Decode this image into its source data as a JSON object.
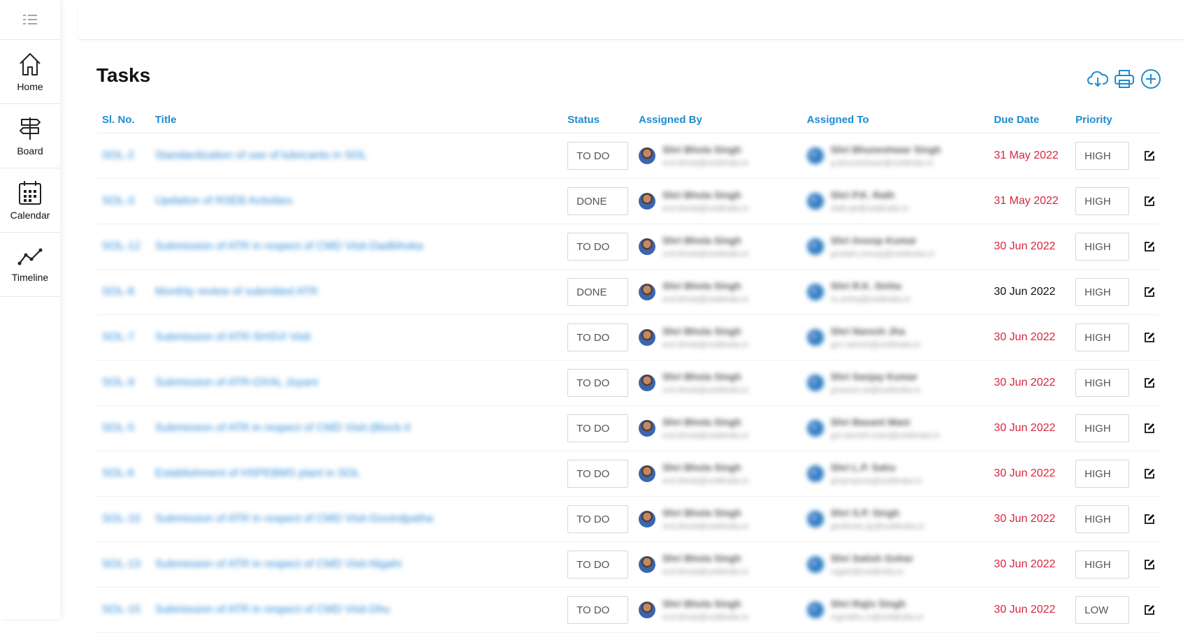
{
  "sidebar": {
    "items": [
      {
        "label": "Home",
        "icon": "home-icon"
      },
      {
        "label": "Board",
        "icon": "signpost-icon"
      },
      {
        "label": "Calendar",
        "icon": "calendar-icon"
      },
      {
        "label": "Timeline",
        "icon": "timeline-icon"
      }
    ]
  },
  "header": {
    "theme_toggle": "off",
    "avatar": "user-avatar"
  },
  "page": {
    "title": "Tasks",
    "actions": [
      "download-icon",
      "print-icon",
      "add-icon"
    ]
  },
  "colors": {
    "accent": "#1e8cd0",
    "overdue": "#d7263d"
  },
  "table": {
    "headers": {
      "sl_no": "Sl. No.",
      "title": "Title",
      "status": "Status",
      "assigned_by": "Assigned By",
      "assigned_to": "Assigned To",
      "due_date": "Due Date",
      "priority": "Priority"
    },
    "rows": [
      {
        "sl": "SOL-2",
        "title": "Standardization of use of lubricants in SOL",
        "status": "TO DO",
        "by_name": "Shri Bhola Singh",
        "by_email": "srsl.bhola@soldindia.in",
        "to_name": "Shri Bhuneshwar Singh",
        "to_email": "g.bhuneshwar@soldindia.in",
        "due": "31 May 2022",
        "overdue": true,
        "priority": "HIGH"
      },
      {
        "sl": "SOL-3",
        "title": "Updation of RSEB Activities",
        "status": "DONE",
        "by_name": "Shri Bhola Singh",
        "by_email": "srsl.bhola@soldindia.in",
        "to_name": "Shri P.K. Rath",
        "to_email": "rtlab.pk@soldindia.in",
        "due": "31 May 2022",
        "overdue": true,
        "priority": "HIGH"
      },
      {
        "sl": "SOL-12",
        "title": "Submission of ATR in respect of CMD Visit-Dadibhoka",
        "status": "TO DO",
        "by_name": "Shri Bhola Singh",
        "by_email": "srsl.bhola@soldindia.in",
        "to_name": "Shri Anoop Kumar",
        "to_email": "gmadm.anoop@soldindia.in",
        "due": "30 Jun 2022",
        "overdue": true,
        "priority": "HIGH"
      },
      {
        "sl": "SOL-8",
        "title": "Monthly review of submitted ATR",
        "status": "DONE",
        "by_name": "Shri Bhola Singh",
        "by_email": "srsl.bhola@soldindia.in",
        "to_name": "Shri R.K. Sinha",
        "to_email": "rs.sinha@soldindia.in",
        "due": "30 Jun 2022",
        "overdue": false,
        "priority": "HIGH"
      },
      {
        "sl": "SOL-7",
        "title": "Submission of ATR-SHSVI Visit",
        "status": "TO DO",
        "by_name": "Shri Bhola Singh",
        "by_email": "srsl.bhola@soldindia.in",
        "to_name": "Shri Naresh Jha",
        "to_email": "gm.naresh@soldindia.in",
        "due": "30 Jun 2022",
        "overdue": true,
        "priority": "HIGH"
      },
      {
        "sl": "SOL-9",
        "title": "Submission of ATR-OXAL Joyani",
        "status": "TO DO",
        "by_name": "Shri Bhola Singh",
        "by_email": "srsl.bhola@soldindia.in",
        "to_name": "Shri Sanjay Kumar",
        "to_email": "gmwest.sk@soldindia.in",
        "due": "30 Jun 2022",
        "overdue": true,
        "priority": "HIGH"
      },
      {
        "sl": "SOL-5",
        "title": "Submission of ATR in respect of CMD Visit-(Block-II",
        "status": "TO DO",
        "by_name": "Shri Bhola Singh",
        "by_email": "srsl.bhola@soldindia.in",
        "to_name": "Shri Basant Mani",
        "to_email": "gm.blockII.mani@soldindia.in",
        "due": "30 Jun 2022",
        "overdue": true,
        "priority": "HIGH"
      },
      {
        "sl": "SOL-6",
        "title": "Establishment of HSPEBMS plant in SOL",
        "status": "TO DO",
        "by_name": "Shri Bhola Singh",
        "by_email": "srsl.bhola@soldindia.in",
        "to_name": "Shri L.P. Sahu",
        "to_email": "gmprojects@soldindia.in",
        "due": "30 Jun 2022",
        "overdue": true,
        "priority": "HIGH"
      },
      {
        "sl": "SOL-10",
        "title": "Submission of ATR in respect of CMD Visit-Govindpatha",
        "status": "TO DO",
        "by_name": "Shri Bhola Singh",
        "by_email": "srsl.bhola@soldindia.in",
        "to_name": "Shri S.P. Singh",
        "to_email": "gmbhola.sp@soldindia.in",
        "due": "30 Jun 2022",
        "overdue": true,
        "priority": "HIGH"
      },
      {
        "sl": "SOL-13",
        "title": "Submission of ATR in respect of CMD Visit-Nigahi",
        "status": "TO DO",
        "by_name": "Shri Bhola Singh",
        "by_email": "srsl.bhola@soldindia.in",
        "to_name": "Shri Satish Gohar",
        "to_email": "nigahi@soldindia.in",
        "due": "30 Jun 2022",
        "overdue": true,
        "priority": "HIGH"
      },
      {
        "sl": "SOL-15",
        "title": "Submission of ATR in respect of CMD Visit-Dhu",
        "status": "TO DO",
        "by_name": "Shri Bhola Singh",
        "by_email": "srsl.bhola@soldindia.in",
        "to_name": "Shri Rajiv Singh",
        "to_email": "rsgmdhu.rs@soldindia.in",
        "due": "30 Jun 2022",
        "overdue": true,
        "priority": "LOW"
      }
    ]
  }
}
